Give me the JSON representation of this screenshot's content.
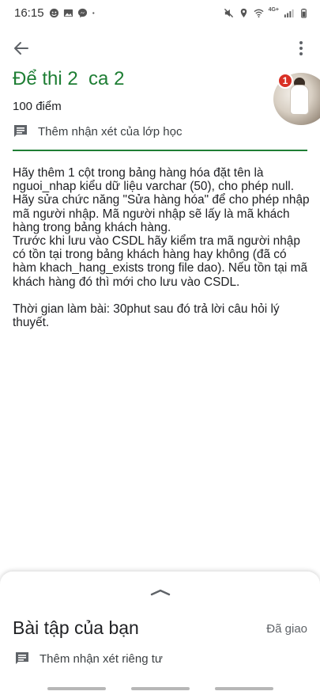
{
  "status_bar": {
    "time": "16:15",
    "left_icons": [
      "emoji-icon",
      "gallery-icon",
      "messenger-icon",
      "dot-icon"
    ],
    "right_icons": [
      "mute-icon",
      "location-icon",
      "wifi-icon",
      "lte-icon",
      "signal-icon",
      "battery-icon"
    ],
    "network_label": "4G+"
  },
  "app_bar": {
    "back_icon": "arrow-back-icon",
    "more_icon": "more-vert-icon"
  },
  "assignment": {
    "title": "Để thi 2  ca 2",
    "points": "100 điểm",
    "class_comment_label": "Thêm nhận xét của lớp học",
    "avatar_badge_count": "1",
    "description": [
      "Hãy thêm 1 cột trong bảng hàng hóa đặt tên là nguoi_nhap kiểu dữ liệu varchar (50), cho phép null.",
      "Hãy sửa chức năng \"Sửa hàng hóa\" để cho phép nhập mã người nhập. Mã người nhập sẽ lấy là mã khách hàng trong bảng khách hàng.",
      "Trước khi lưu vào CSDL hãy kiểm tra mã người nhập có tồn tại trong bảng khách hàng hay  không (đã có hàm khach_hang_exists trong file dao). Nếu tồn tại mã khách hàng đó thì mới cho lưu vào CSDL.",
      "",
      "Thời gian làm bài: 30phut sau đó trả lời câu hỏi lý thuyết."
    ]
  },
  "your_work": {
    "title": "Bài tập của bạn",
    "status": "Đã giao",
    "private_comment_label": "Thêm nhận xét riêng tư"
  },
  "colors": {
    "accent_green": "#1e7e34",
    "badge_red": "#d93025",
    "text": "#202124",
    "muted": "#5f6368"
  }
}
